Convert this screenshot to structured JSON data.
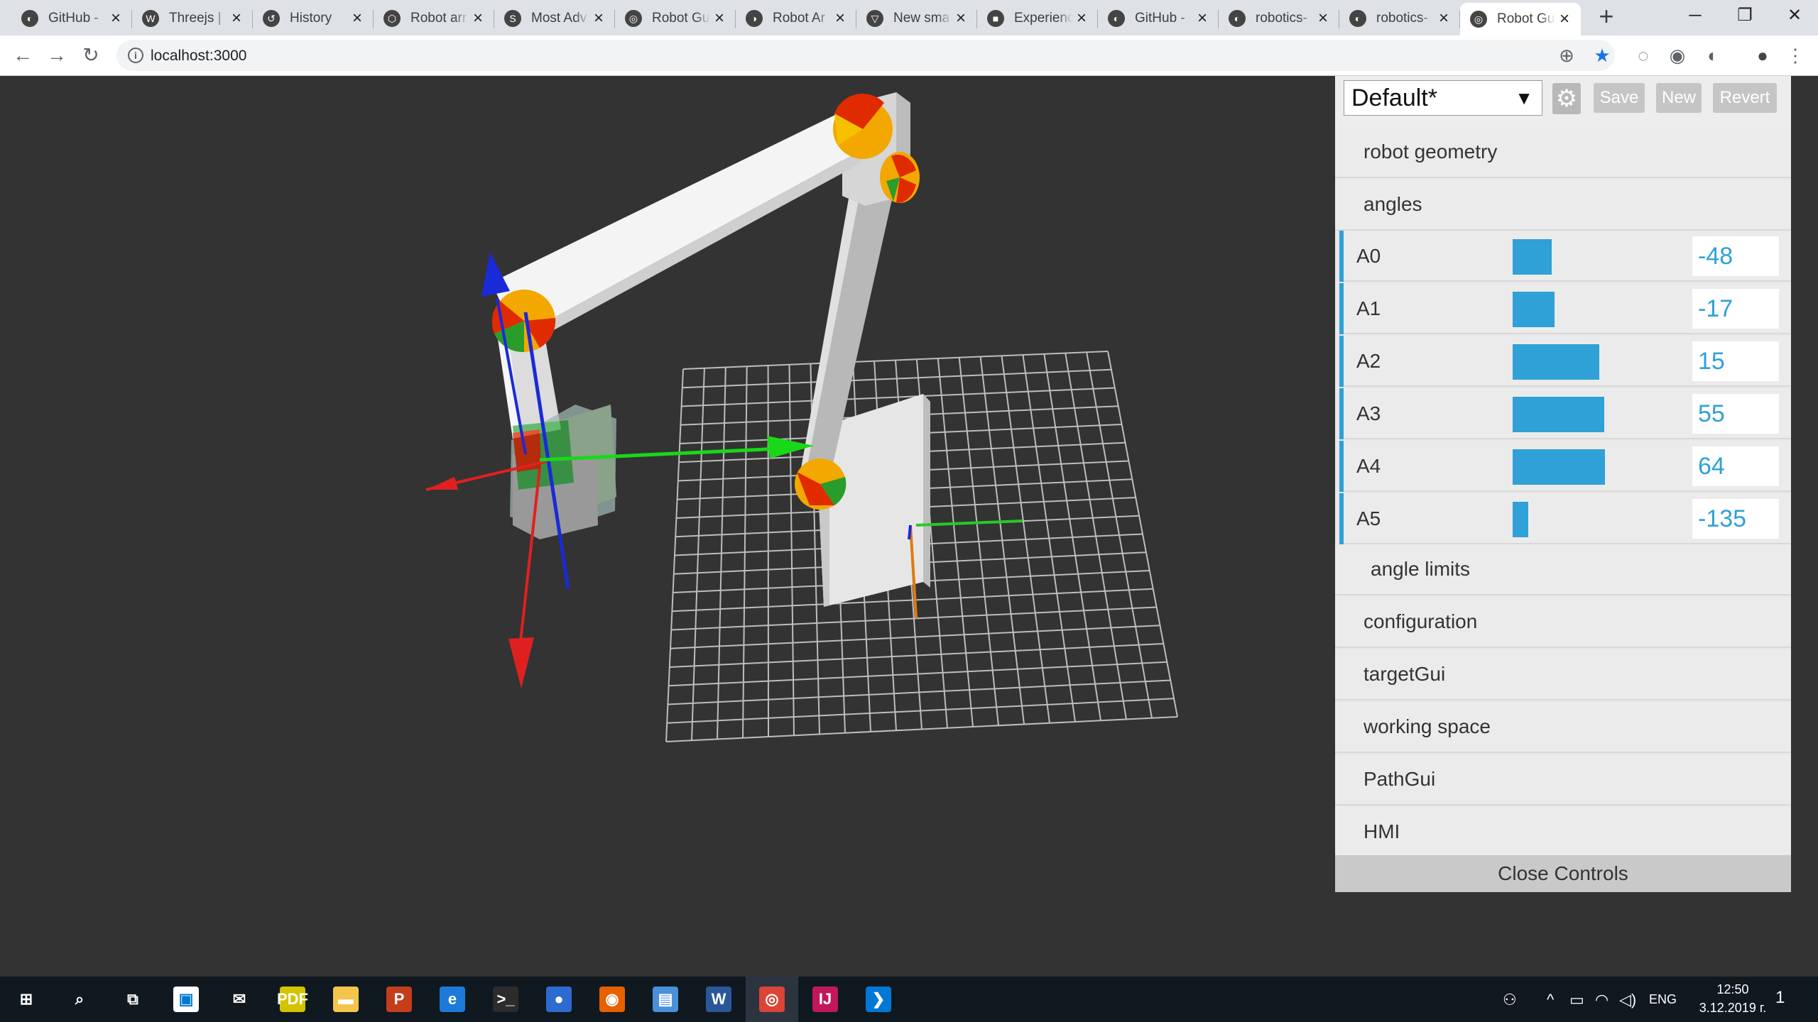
{
  "browser": {
    "tabs": [
      {
        "title": "GitHub - ",
        "icon": "github-icon",
        "glyph": "◐"
      },
      {
        "title": "Threejs | ",
        "icon": "wordpress-icon",
        "glyph": "W"
      },
      {
        "title": "History",
        "icon": "history-icon",
        "glyph": "↺"
      },
      {
        "title": "Robot arr",
        "icon": "codepen-icon",
        "glyph": "⬡"
      },
      {
        "title": "Most Adv",
        "icon": "s-logo-icon",
        "glyph": "S"
      },
      {
        "title": "Robot Gu",
        "icon": "globe-icon",
        "glyph": "◎"
      },
      {
        "title": "Robot Ar",
        "icon": "site-icon",
        "glyph": "◑"
      },
      {
        "title": "New sma",
        "icon": "flag-icon",
        "glyph": "▽"
      },
      {
        "title": "Experienc",
        "icon": "dark-site-icon",
        "glyph": "■"
      },
      {
        "title": "GitHub - ",
        "icon": "github-icon",
        "glyph": "◐"
      },
      {
        "title": "robotics-",
        "icon": "github-icon",
        "glyph": "◐"
      },
      {
        "title": "robotics-",
        "icon": "github-icon",
        "glyph": "◐"
      },
      {
        "title": "Robot Gu",
        "icon": "globe-icon",
        "glyph": "◎",
        "active": true
      }
    ],
    "new_tab": "+",
    "window_controls": {
      "minimize": "─",
      "maximize": "❐",
      "close": "✕"
    },
    "address": {
      "url": "localhost:3000"
    },
    "nav": {
      "back": "←",
      "forward": "→",
      "reload": "↻"
    },
    "toolbar_icons": {
      "zoom": "⊕",
      "bookmark": "★",
      "ext1": "◌",
      "ext2": "◉",
      "ext3": "◐",
      "account": "●",
      "menu": "⋮"
    }
  },
  "gui": {
    "preset": "Default*",
    "preset_arrow": "▼",
    "gear": "⚙",
    "buttons": {
      "save": "Save",
      "new": "New",
      "revert": "Revert"
    },
    "folders": {
      "robot_geometry": "robot geometry",
      "angles": "angles",
      "angle_limits": "angle limits",
      "configuration": "configuration",
      "targetGui": "targetGui",
      "working_space": "working space",
      "pathGui": "PathGui",
      "hmi": "HMI"
    },
    "angles": [
      {
        "name": "A0",
        "value": "-48",
        "fill_fraction": 0.235
      },
      {
        "name": "A1",
        "value": "-17",
        "fill_fraction": 0.253
      },
      {
        "name": "A2",
        "value": "15",
        "fill_fraction": 0.52
      },
      {
        "name": "A3",
        "value": "55",
        "fill_fraction": 0.55
      },
      {
        "name": "A4",
        "value": "64",
        "fill_fraction": 0.555
      },
      {
        "name": "A5",
        "value": "-135",
        "fill_fraction": 0.095
      }
    ],
    "close_label": "Close Controls",
    "accent_color": "#2fa1d6"
  },
  "taskbar": {
    "apps": [
      {
        "name": "start-icon",
        "glyph": "⊞",
        "color": "transparent"
      },
      {
        "name": "search-icon",
        "glyph": "⌕",
        "color": "transparent"
      },
      {
        "name": "task-view-icon",
        "glyph": "⧉",
        "color": "transparent"
      },
      {
        "name": "store-icon",
        "glyph": "▣",
        "color": "#ffffff"
      },
      {
        "name": "mail-icon",
        "glyph": "✉",
        "color": "transparent"
      },
      {
        "name": "pdf-icon",
        "glyph": "PDF",
        "color": "#d4c400"
      },
      {
        "name": "explorer-icon",
        "glyph": "▬",
        "color": "#f5c44a"
      },
      {
        "name": "powerpoint-icon",
        "glyph": "P",
        "color": "#c43e1c"
      },
      {
        "name": "edge-icon",
        "glyph": "e",
        "color": "#1e7ad8"
      },
      {
        "name": "terminal-icon",
        "glyph": ">_",
        "color": "#2c2c2c"
      },
      {
        "name": "chat-icon",
        "glyph": "●",
        "color": "#2d6bd0"
      },
      {
        "name": "firefox-icon",
        "glyph": "◉",
        "color": "#e66000"
      },
      {
        "name": "notepad-icon",
        "glyph": "▤",
        "color": "#4a90d9"
      },
      {
        "name": "word-icon",
        "glyph": "W",
        "color": "#2b579a"
      },
      {
        "name": "chrome-icon",
        "glyph": "◎",
        "color": "#db4437",
        "active": true
      },
      {
        "name": "intellij-icon",
        "glyph": "IJ",
        "color": "#c2185b"
      },
      {
        "name": "vscode-icon",
        "glyph": "❯",
        "color": "#0078d4"
      }
    ],
    "tray": {
      "people": "⚇",
      "chevron": "^",
      "battery": "▭",
      "wifi": "◠",
      "volume": "◁)",
      "lang": "ENG",
      "notifications": "1"
    },
    "clock_time": "12:50",
    "clock_date": "3.12.2019 г."
  }
}
